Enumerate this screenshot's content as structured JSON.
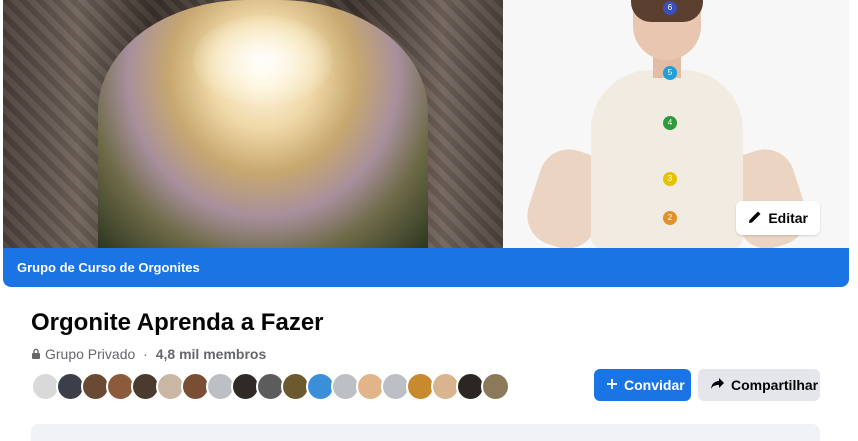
{
  "cover": {
    "edit_label": "Editar",
    "group_bar_label": "Grupo de Curso de Orgonites",
    "chakra_numbers": [
      "6",
      "5",
      "4",
      "3",
      "2"
    ]
  },
  "group": {
    "name": "Orgonite Aprenda a Fazer",
    "privacy": "Grupo Privado",
    "separator": " · ",
    "members": "4,8 mil membros"
  },
  "actions": {
    "invite_label": "Convidar",
    "share_label": "Compartilhar"
  },
  "colors": {
    "primary": "#1b74e4",
    "secondary_button": "#e4e6eb",
    "muted_text": "#65676b"
  }
}
